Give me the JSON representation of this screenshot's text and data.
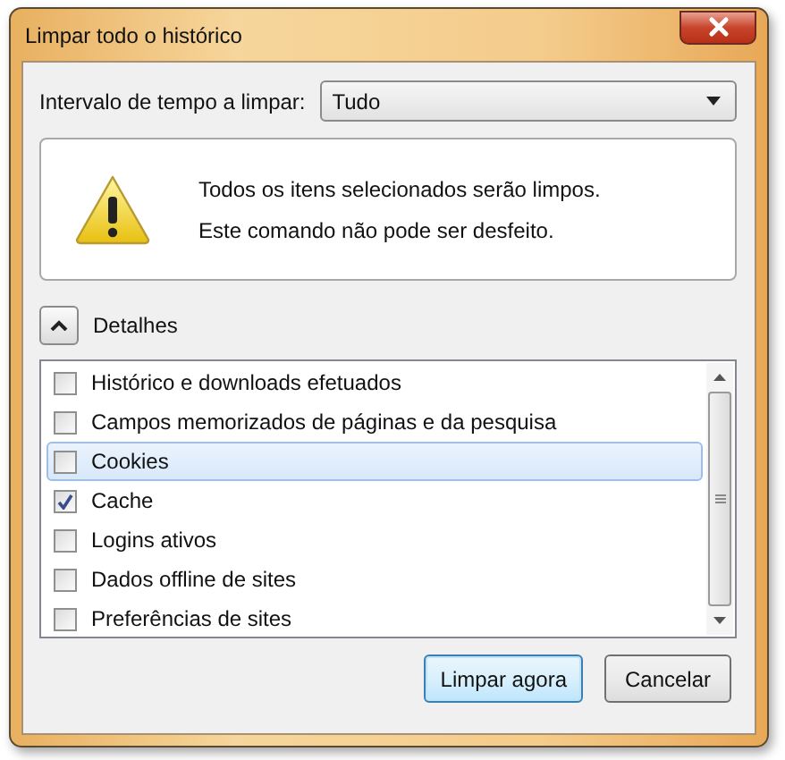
{
  "window": {
    "title": "Limpar todo o histórico"
  },
  "range": {
    "label": "Intervalo de tempo a limpar:",
    "value": "Tudo"
  },
  "warning": {
    "lines": [
      "Todos os itens selecionados serão limpos.",
      "Este comando não pode ser desfeito."
    ]
  },
  "details": {
    "label": "Detalhes",
    "expanded": true
  },
  "items": [
    {
      "label": "Histórico e downloads efetuados",
      "checked": false,
      "selected": false
    },
    {
      "label": "Campos memorizados de páginas e da pesquisa",
      "checked": false,
      "selected": false
    },
    {
      "label": "Cookies",
      "checked": false,
      "selected": true
    },
    {
      "label": "Cache",
      "checked": true,
      "selected": false
    },
    {
      "label": "Logins ativos",
      "checked": false,
      "selected": false
    },
    {
      "label": "Dados offline de sites",
      "checked": false,
      "selected": false
    },
    {
      "label": "Preferências de sites",
      "checked": false,
      "selected": false
    }
  ],
  "buttons": [
    {
      "label": "Limpar agora",
      "default": true
    },
    {
      "label": "Cancelar",
      "default": false
    }
  ]
}
